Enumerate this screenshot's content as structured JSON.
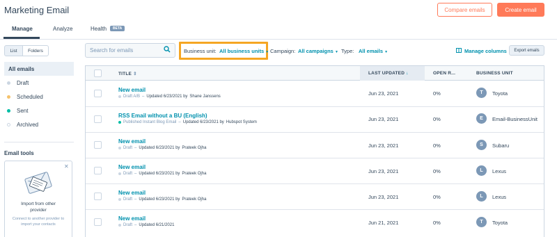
{
  "header": {
    "title": "Marketing Email",
    "compare_label": "Compare emails",
    "create_label": "Create email"
  },
  "tabs": {
    "manage": "Manage",
    "analyze": "Analyze",
    "health": "Health",
    "beta_badge": "BETA"
  },
  "sidebar": {
    "view_list": "List",
    "view_folders": "Folders",
    "all_emails": "All emails",
    "items": [
      {
        "label": "Draft",
        "color": "#cbd6e2"
      },
      {
        "label": "Scheduled",
        "color": "#f5c26b"
      },
      {
        "label": "Sent",
        "color": "#00bda5"
      },
      {
        "label": "Archived",
        "color": "#ffffff"
      }
    ],
    "tools_heading": "Email tools",
    "tool_card": {
      "title": "Import from other provider",
      "description": "Connect to another provider to import your contacts"
    }
  },
  "filters": {
    "search_placeholder": "Search for emails",
    "business_unit_label": "Business unit:",
    "business_unit_value": "All business units",
    "campaign_label": "Campaign:",
    "campaign_value": "All campaigns",
    "type_label": "Type:",
    "type_value": "All emails",
    "manage_columns": "Manage columns",
    "export_label": "Export emails",
    "highlight_color": "#f5a623"
  },
  "table": {
    "columns": {
      "title": "TITLE",
      "last_updated": "LAST UPDATED",
      "open_rate": "OPEN R...",
      "business_unit": "BUSINESS UNIT"
    },
    "rows": [
      {
        "name": "New email",
        "status": "Draft A/B",
        "status_color": "#cbd6e2",
        "updated": "Updated 6/23/2021 by",
        "author": "Shane Janssens",
        "date": "Jun 23, 2021",
        "open_rate": "0%",
        "bu_initial": "T",
        "bu_name": "Toyota"
      },
      {
        "name": "RSS Email without a BU (English)",
        "status": "Published Instant Blog Email",
        "status_color": "#00bda5",
        "updated": "Updated 6/23/2021 by",
        "author": "Hubspot System",
        "date": "Jun 23, 2021",
        "open_rate": "0%",
        "bu_initial": "E",
        "bu_name": "Email-BusinessUnit"
      },
      {
        "name": "New email",
        "status": "Draft",
        "status_color": "#cbd6e2",
        "updated": "Updated 6/23/2021 by",
        "author": "Prateek Ojha",
        "date": "Jun 23, 2021",
        "open_rate": "0%",
        "bu_initial": "S",
        "bu_name": "Subaru"
      },
      {
        "name": "New email",
        "status": "Draft",
        "status_color": "#cbd6e2",
        "updated": "Updated 6/23/2021 by",
        "author": "Prateek Ojha",
        "date": "Jun 23, 2021",
        "open_rate": "0%",
        "bu_initial": "L",
        "bu_name": "Lexus"
      },
      {
        "name": "New email",
        "status": "Draft",
        "status_color": "#cbd6e2",
        "updated": "Updated 6/23/2021 by",
        "author": "Prateek Ojha",
        "date": "Jun 23, 2021",
        "open_rate": "0%",
        "bu_initial": "L",
        "bu_name": "Lexus"
      },
      {
        "name": "New email",
        "status": "Draft",
        "status_color": "#cbd6e2",
        "updated": "Updated 6/21/2021",
        "author": "",
        "date": "Jun 21, 2021",
        "open_rate": "0%",
        "bu_initial": "T",
        "bu_name": "Toyota"
      }
    ]
  },
  "colors": {
    "accent": "#ff7a59",
    "link": "#0091ae",
    "text": "#33475b"
  }
}
